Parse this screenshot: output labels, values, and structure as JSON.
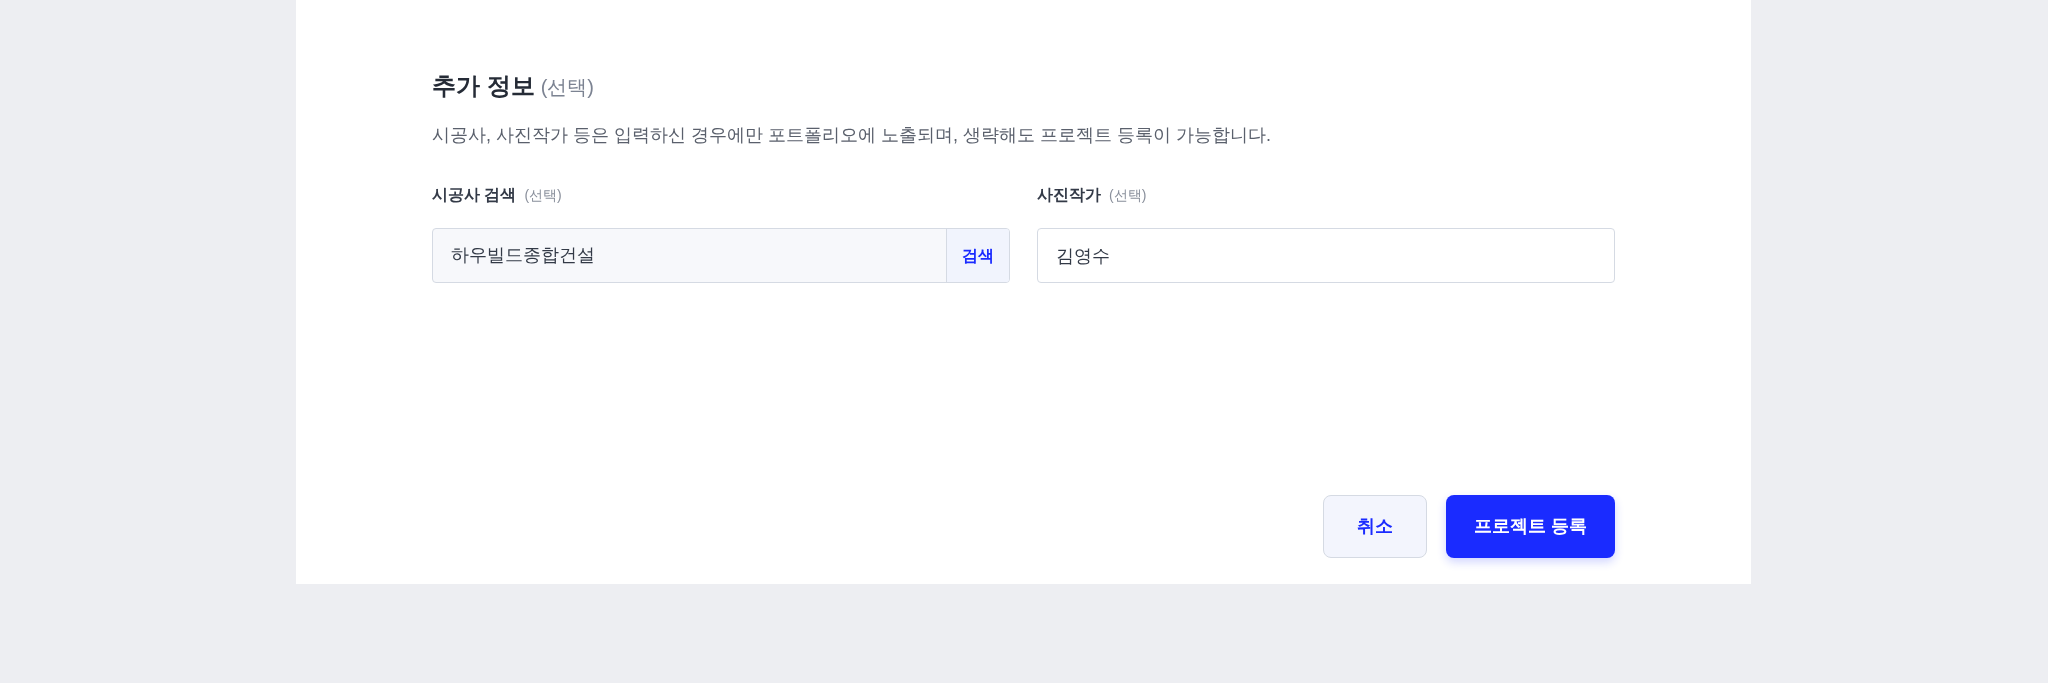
{
  "section": {
    "title": "추가 정보",
    "title_note": "(선택)",
    "description": "시공사, 사진작가 등은 입력하신 경우에만 포트폴리오에 노출되며, 생략해도 프로젝트 등록이 가능합니다."
  },
  "fields": [
    {
      "kind": "search",
      "label": "시공사 검색",
      "note": "(선택)",
      "value": "하우빌드종합건설",
      "button": "검색"
    },
    {
      "kind": "text",
      "label": "사진작가",
      "note": "(선택)",
      "value": "김영수"
    }
  ],
  "actions": [
    {
      "label": "취소",
      "kind": "secondary"
    },
    {
      "label": "프로젝트 등록",
      "kind": "primary"
    }
  ]
}
